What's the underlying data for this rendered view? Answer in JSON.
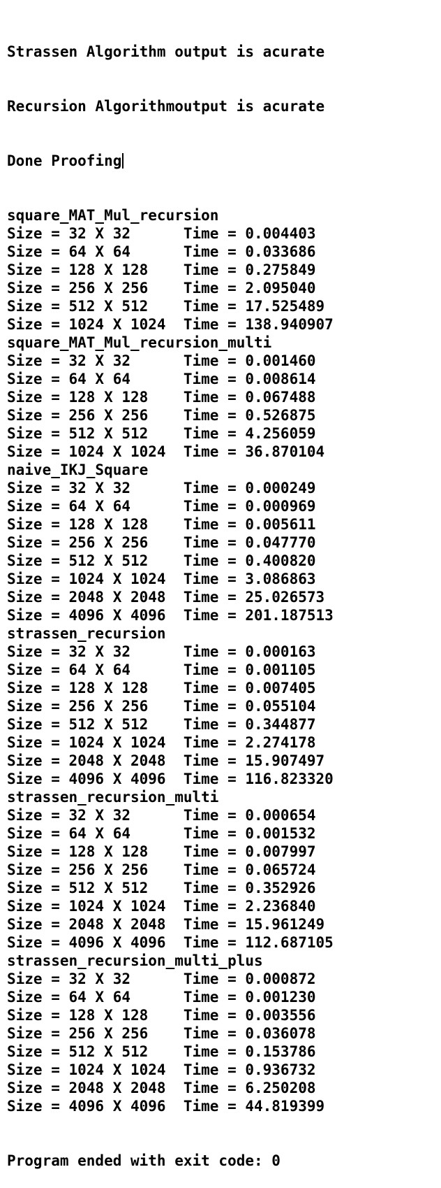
{
  "console": {
    "header_lines": [
      "Strassen Algorithm output is acurate",
      "Recursion Algorithmoutput is acurate",
      "Done Proofing"
    ],
    "sections": [
      {
        "title": "square_MAT_Mul_recursion",
        "rows": [
          {
            "size": "Size = 32 X 32",
            "time": "Time = 0.004403"
          },
          {
            "size": "Size = 64 X 64",
            "time": "Time = 0.033686"
          },
          {
            "size": "Size = 128 X 128",
            "time": "Time = 0.275849"
          },
          {
            "size": "Size = 256 X 256",
            "time": "Time = 2.095040"
          },
          {
            "size": "Size = 512 X 512",
            "time": "Time = 17.525489"
          },
          {
            "size": "Size = 1024 X 1024",
            "time": "Time = 138.940907"
          }
        ]
      },
      {
        "title": "square_MAT_Mul_recursion_multi",
        "rows": [
          {
            "size": "Size = 32 X 32",
            "time": "Time = 0.001460"
          },
          {
            "size": "Size = 64 X 64",
            "time": "Time = 0.008614"
          },
          {
            "size": "Size = 128 X 128",
            "time": "Time = 0.067488"
          },
          {
            "size": "Size = 256 X 256",
            "time": "Time = 0.526875"
          },
          {
            "size": "Size = 512 X 512",
            "time": "Time = 4.256059"
          },
          {
            "size": "Size = 1024 X 1024",
            "time": "Time = 36.870104"
          }
        ]
      },
      {
        "title": "naive_IKJ_Square",
        "rows": [
          {
            "size": "Size = 32 X 32",
            "time": "Time = 0.000249"
          },
          {
            "size": "Size = 64 X 64",
            "time": "Time = 0.000969"
          },
          {
            "size": "Size = 128 X 128",
            "time": "Time = 0.005611"
          },
          {
            "size": "Size = 256 X 256",
            "time": "Time = 0.047770"
          },
          {
            "size": "Size = 512 X 512",
            "time": "Time = 0.400820"
          },
          {
            "size": "Size = 1024 X 1024",
            "time": "Time = 3.086863"
          },
          {
            "size": "Size = 2048 X 2048",
            "time": "Time = 25.026573"
          },
          {
            "size": "Size = 4096 X 4096",
            "time": "Time = 201.187513"
          }
        ]
      },
      {
        "title": "strassen_recursion",
        "rows": [
          {
            "size": "Size = 32 X 32",
            "time": "Time = 0.000163"
          },
          {
            "size": "Size = 64 X 64",
            "time": "Time = 0.001105"
          },
          {
            "size": "Size = 128 X 128",
            "time": "Time = 0.007405"
          },
          {
            "size": "Size = 256 X 256",
            "time": "Time = 0.055104"
          },
          {
            "size": "Size = 512 X 512",
            "time": "Time = 0.344877"
          },
          {
            "size": "Size = 1024 X 1024",
            "time": "Time = 2.274178"
          },
          {
            "size": "Size = 2048 X 2048",
            "time": "Time = 15.907497"
          },
          {
            "size": "Size = 4096 X 4096",
            "time": "Time = 116.823320"
          }
        ]
      },
      {
        "title": "strassen_recursion_multi",
        "rows": [
          {
            "size": "Size = 32 X 32",
            "time": "Time = 0.000654"
          },
          {
            "size": "Size = 64 X 64",
            "time": "Time = 0.001532"
          },
          {
            "size": "Size = 128 X 128",
            "time": "Time = 0.007997"
          },
          {
            "size": "Size = 256 X 256",
            "time": "Time = 0.065724"
          },
          {
            "size": "Size = 512 X 512",
            "time": "Time = 0.352926"
          },
          {
            "size": "Size = 1024 X 1024",
            "time": "Time = 2.236840"
          },
          {
            "size": "Size = 2048 X 2048",
            "time": "Time = 15.961249"
          },
          {
            "size": "Size = 4096 X 4096",
            "time": "Time = 112.687105"
          }
        ]
      },
      {
        "title": "strassen_recursion_multi_plus",
        "rows": [
          {
            "size": "Size = 32 X 32",
            "time": "Time = 0.000872"
          },
          {
            "size": "Size = 64 X 64",
            "time": "Time = 0.001230"
          },
          {
            "size": "Size = 128 X 128",
            "time": "Time = 0.003556"
          },
          {
            "size": "Size = 256 X 256",
            "time": "Time = 0.036078"
          },
          {
            "size": "Size = 512 X 512",
            "time": "Time = 0.153786"
          },
          {
            "size": "Size = 1024 X 1024",
            "time": "Time = 0.936732"
          },
          {
            "size": "Size = 2048 X 2048",
            "time": "Time = 6.250208"
          },
          {
            "size": "Size = 4096 X 4096",
            "time": "Time = 44.819399"
          }
        ]
      }
    ],
    "footer_line": "Program ended with exit code: 0"
  }
}
